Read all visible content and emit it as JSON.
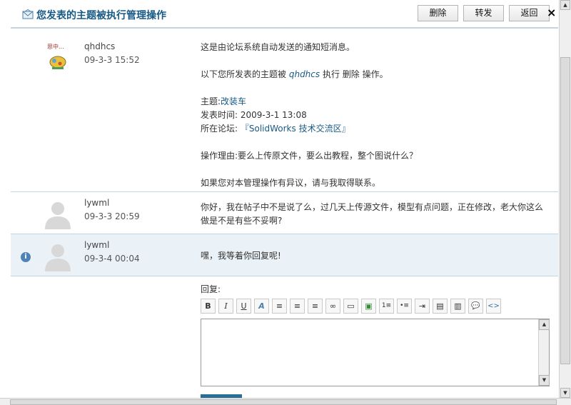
{
  "header": {
    "title": "您发表的主题被执行管理操作",
    "delete_label": "删除",
    "forward_label": "转发",
    "back_label": "返回",
    "close_label": "×"
  },
  "messages": [
    {
      "username": "qhdhcs",
      "time": "09-3-3 15:52",
      "avatar_caption": "思中...",
      "lines": {
        "intro": "这是由论坛系统自动发送的通知短消息。",
        "op_prefix": "以下您所发表的主题被",
        "op_actor": "qhdhcs",
        "op_suffix": "执行 删除 操作。",
        "subject_label": "主题:",
        "subject_value": "改装车",
        "posted_label": "发表时间:",
        "posted_value": "2009-3-1 13:08",
        "forum_label": "所在论坛:",
        "forum_value": "『SolidWorks 技术交流区』",
        "reason": "操作理由:要么上传原文件，要么出教程，整个图说什么？",
        "contact": "如果您对本管理操作有异议，请与我取得联系。"
      }
    },
    {
      "username": "lywml",
      "time": "09-3-3 20:59",
      "lines": {
        "line1": "你好，我在帖子中不是说了么，过几天上传源文件，模型有点问题，正在修改，老大你这么",
        "line2": "做是不是有些不妥啊?"
      }
    },
    {
      "username": "lywml",
      "time": "09-3-4 00:04",
      "lines": {
        "line1": "嘿，我等着你回复呢!"
      },
      "info_icon": "info-icon"
    }
  ],
  "reply": {
    "label": "回复:",
    "toolbar": [
      "B",
      "I",
      "U",
      "A",
      "≡",
      "≡",
      "≡",
      "∞",
      "▭",
      "▣",
      "1≡",
      "•≡",
      "⇥",
      "▤",
      "▥",
      "💬",
      "<>"
    ]
  },
  "colors": {
    "accent": "#175a85",
    "border": "#c2d5e3",
    "highlight_row": "#ebf2f7"
  }
}
